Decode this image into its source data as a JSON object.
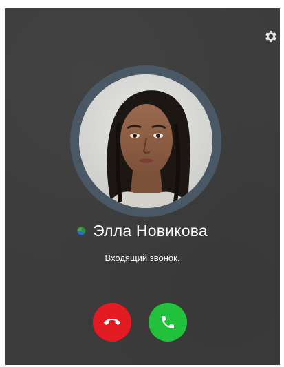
{
  "caller": {
    "name": "Элла Новикова",
    "status_text": "Входящий звонок."
  },
  "icons": {
    "settings": "gear-icon",
    "presence": "presence-status-icon",
    "decline": "phone-hangup-icon",
    "accept": "phone-icon"
  },
  "colors": {
    "background": "#3b3c3b",
    "avatar_ring": "#4a5865",
    "decline": "#e31b23",
    "accept": "#22c13c",
    "text": "#ffffff"
  }
}
